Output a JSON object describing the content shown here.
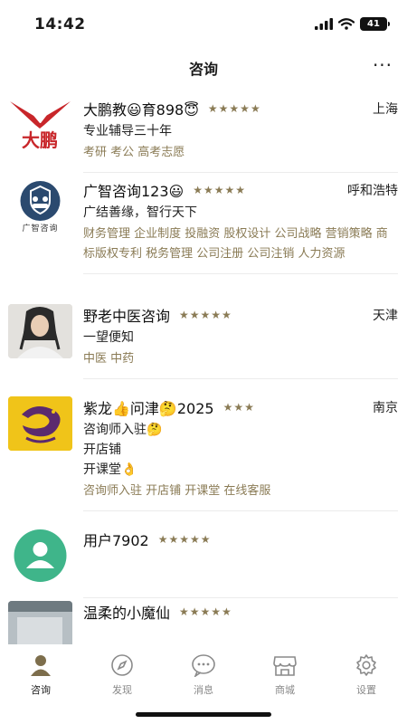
{
  "status_bar": {
    "time": "14:42",
    "battery": "41"
  },
  "header": {
    "title": "咨询",
    "more_label": "···"
  },
  "consultants": [
    {
      "name": "大鹏教😃育898😇",
      "stars": "★★★★★",
      "city": "上海",
      "lines": [
        "专业辅导三十年"
      ],
      "tags": "考研 考公 高考志愿",
      "avatar": "eagle-logo"
    },
    {
      "name": "广智咨询123😃",
      "stars": "★★★★★",
      "city": "呼和浩特",
      "lines": [
        "广结善缘，智行天下"
      ],
      "tags": "财务管理 企业制度 投融资 股权设计 公司战略 营销策略 商标版权专利 税务管理 公司注册 公司注销 人力资源",
      "avatar": "guangzhi-logo",
      "avatar_text": "广智咨询"
    },
    {
      "name": "野老中医咨询",
      "stars": "★★★★★",
      "city": "天津",
      "lines": [
        "一望便知"
      ],
      "tags": "中医 中药",
      "avatar": "portrait-photo"
    },
    {
      "name": "紫龙👍问津🤔2025",
      "stars": "★★★",
      "city": "南京",
      "lines": [
        "咨询师入驻🤔",
        "开店铺",
        "开课堂👌"
      ],
      "tags": "咨询师入驻 开店铺 开课堂 在线客服",
      "avatar": "dragon-logo"
    },
    {
      "name": "用户7902",
      "stars": "★★★★★",
      "city": "",
      "lines": [],
      "tags": "",
      "avatar": "default-user"
    },
    {
      "name": "温柔的小魔仙",
      "stars": "★★★★★",
      "city": "",
      "lines": [],
      "tags": "",
      "avatar": "photo-thumb"
    }
  ],
  "tabs": [
    {
      "label": "咨询",
      "icon": "person-icon",
      "active": true
    },
    {
      "label": "发现",
      "icon": "compass-icon",
      "active": false
    },
    {
      "label": "消息",
      "icon": "chat-bubble-icon",
      "active": false
    },
    {
      "label": "商城",
      "icon": "store-icon",
      "active": false
    },
    {
      "label": "设置",
      "icon": "gear-icon",
      "active": false
    }
  ],
  "colors": {
    "accent": "#8a7b55",
    "text": "#1a1a1a",
    "muted": "#888888"
  }
}
